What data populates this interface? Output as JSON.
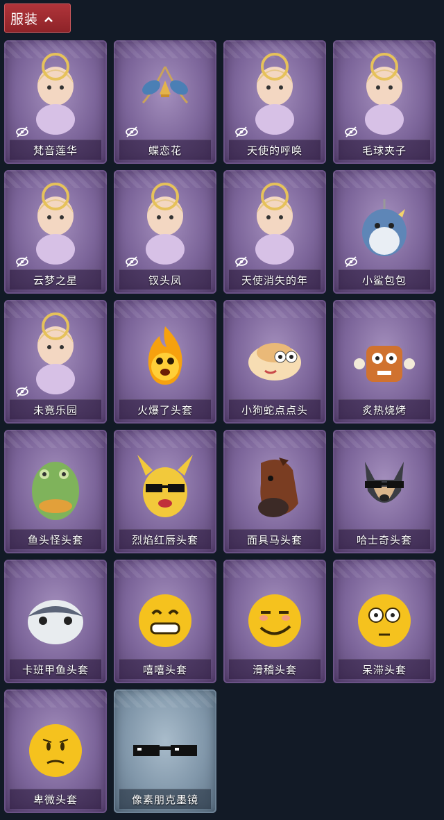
{
  "section": {
    "title": "服装",
    "chevron_icon": "chevron-up-icon"
  },
  "colors": {
    "header_bg": "#9e2b31",
    "card_purple": "#7c659a",
    "card_blue": "#8197aa",
    "page_bg": "#121a26"
  },
  "items": [
    {
      "label": "梵音莲华",
      "hidden_icon": true,
      "style": "purple",
      "art": "figure"
    },
    {
      "label": "蝶恋花",
      "hidden_icon": true,
      "style": "purple",
      "art": "ornament"
    },
    {
      "label": "天使的呼唤",
      "hidden_icon": true,
      "style": "purple",
      "art": "figure"
    },
    {
      "label": "毛球夹子",
      "hidden_icon": true,
      "style": "purple",
      "art": "figure"
    },
    {
      "label": "云梦之星",
      "hidden_icon": true,
      "style": "purple",
      "art": "figure"
    },
    {
      "label": "钗头凤",
      "hidden_icon": true,
      "style": "purple",
      "art": "figure"
    },
    {
      "label": "天使消失的年",
      "hidden_icon": true,
      "style": "purple",
      "art": "figure"
    },
    {
      "label": "小鲨包包",
      "hidden_icon": true,
      "style": "purple",
      "art": "shark"
    },
    {
      "label": "未竟乐园",
      "hidden_icon": true,
      "style": "purple",
      "art": "figure"
    },
    {
      "label": "火爆了头套",
      "hidden_icon": false,
      "style": "purple",
      "art": "fireball"
    },
    {
      "label": "小狗蛇点点头",
      "hidden_icon": false,
      "style": "purple",
      "art": "snake"
    },
    {
      "label": "炙热烧烤",
      "hidden_icon": false,
      "style": "purple",
      "art": "meat"
    },
    {
      "label": "鱼头怪头套",
      "hidden_icon": false,
      "style": "purple",
      "art": "fishhead"
    },
    {
      "label": "烈焰红唇头套",
      "hidden_icon": false,
      "style": "purple",
      "art": "pika"
    },
    {
      "label": "面具马头套",
      "hidden_icon": false,
      "style": "purple",
      "art": "horse"
    },
    {
      "label": "哈士奇头套",
      "hidden_icon": false,
      "style": "purple",
      "art": "husky"
    },
    {
      "label": "卡班甲鱼头套",
      "hidden_icon": false,
      "style": "purple",
      "art": "fish"
    },
    {
      "label": "嘻嘻头套",
      "hidden_icon": false,
      "style": "purple",
      "art": "grin"
    },
    {
      "label": "滑稽头套",
      "hidden_icon": false,
      "style": "purple",
      "art": "smirk"
    },
    {
      "label": "呆滞头套",
      "hidden_icon": false,
      "style": "purple",
      "art": "stare"
    },
    {
      "label": "卑微头套",
      "hidden_icon": false,
      "style": "purple",
      "art": "humble"
    },
    {
      "label": "像素朋克墨镜",
      "hidden_icon": false,
      "style": "blue",
      "art": "glasses"
    }
  ]
}
